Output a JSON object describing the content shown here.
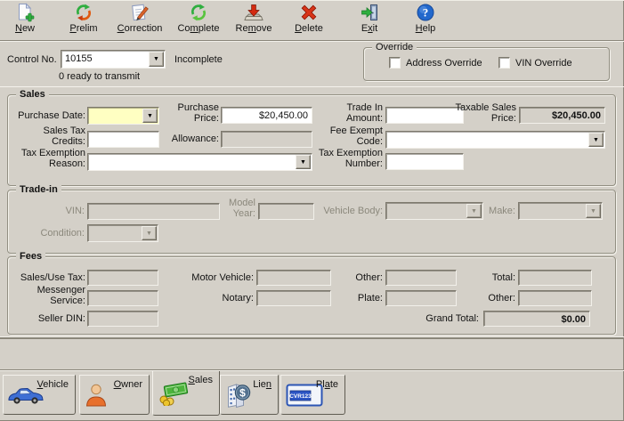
{
  "colors": {
    "window_bg": "#d4d0c8",
    "highlight_yellow": "#ffffc2",
    "disabled_text": "#8b887c"
  },
  "icons": {
    "dropdown_arrow": "▼",
    "help_glyph": "?",
    "lien_symbol": "$",
    "plate_text": "CVR123"
  },
  "toolbar": {
    "buttons": [
      {
        "pre": "",
        "key": "N",
        "post": "ew"
      },
      {
        "pre": "",
        "key": "P",
        "post": "relim"
      },
      {
        "pre": "",
        "key": "C",
        "post": "orrection"
      },
      {
        "pre": "Co",
        "key": "m",
        "post": "plete"
      },
      {
        "pre": "Re",
        "key": "m",
        "post": "ove"
      },
      {
        "pre": "",
        "key": "D",
        "post": "elete"
      },
      {
        "pre": "E",
        "key": "x",
        "post": "it"
      },
      {
        "pre": "",
        "key": "H",
        "post": "elp"
      }
    ]
  },
  "header": {
    "control_label": "Control No.",
    "control_value": "10155",
    "status": "Incomplete",
    "transmit_status": "0 ready to transmit"
  },
  "override": {
    "title": "Override",
    "address_label": "Address Override",
    "address_checked": false,
    "vin_label": "VIN Override",
    "vin_checked": false
  },
  "sales": {
    "title": "Sales",
    "purchase_date": {
      "label": "Purchase Date:",
      "value": ""
    },
    "purchase_price": {
      "label": "Purchase Price:",
      "value": "$20,450.00"
    },
    "trade_in_amount": {
      "label": "Trade In Amount:",
      "value": ""
    },
    "taxable_sales_price": {
      "label": "Taxable Sales Price:",
      "value": "$20,450.00"
    },
    "sales_tax_credits": {
      "label": "Sales Tax Credits:",
      "value": ""
    },
    "allowance": {
      "label": "Allowance:",
      "value": ""
    },
    "fee_exempt_code": {
      "label": "Fee Exempt Code:",
      "value": ""
    },
    "tax_exemption_reason": {
      "label": "Tax Exemption Reason:",
      "value": ""
    },
    "tax_exemption_number": {
      "label": "Tax Exemption Number:",
      "value": ""
    }
  },
  "trade_in": {
    "title": "Trade-in",
    "vin": {
      "label": "VIN:",
      "value": ""
    },
    "model_year": {
      "label": "Model Year:",
      "value": ""
    },
    "vehicle_body": {
      "label": "Vehicle Body:",
      "value": ""
    },
    "make": {
      "label": "Make:",
      "value": ""
    },
    "condition": {
      "label": "Condition:",
      "value": ""
    }
  },
  "fees": {
    "title": "Fees",
    "sales_use_tax": {
      "label": "Sales/Use Tax:",
      "value": ""
    },
    "motor_vehicle": {
      "label": "Motor Vehicle:",
      "value": ""
    },
    "other_1": {
      "label": "Other:",
      "value": ""
    },
    "total": {
      "label": "Total:",
      "value": ""
    },
    "messenger_service": {
      "label": "Messenger Service:",
      "value": ""
    },
    "notary": {
      "label": "Notary:",
      "value": ""
    },
    "plate": {
      "label": "Plate:",
      "value": ""
    },
    "other_2": {
      "label": "Other:",
      "value": ""
    },
    "seller_din": {
      "label": "Seller DIN:",
      "value": ""
    },
    "grand_total": {
      "label": "Grand Total:",
      "value": "$0.00"
    }
  },
  "tabs": [
    {
      "pre": "",
      "key": "V",
      "post": "ehicle",
      "selected": false
    },
    {
      "pre": "",
      "key": "O",
      "post": "wner",
      "selected": false
    },
    {
      "pre": "",
      "key": "S",
      "post": "ales",
      "selected": true
    },
    {
      "pre": "Lie",
      "key": "n",
      "post": "",
      "selected": false
    },
    {
      "pre": "Pl",
      "key": "a",
      "post": "te",
      "selected": false
    }
  ]
}
